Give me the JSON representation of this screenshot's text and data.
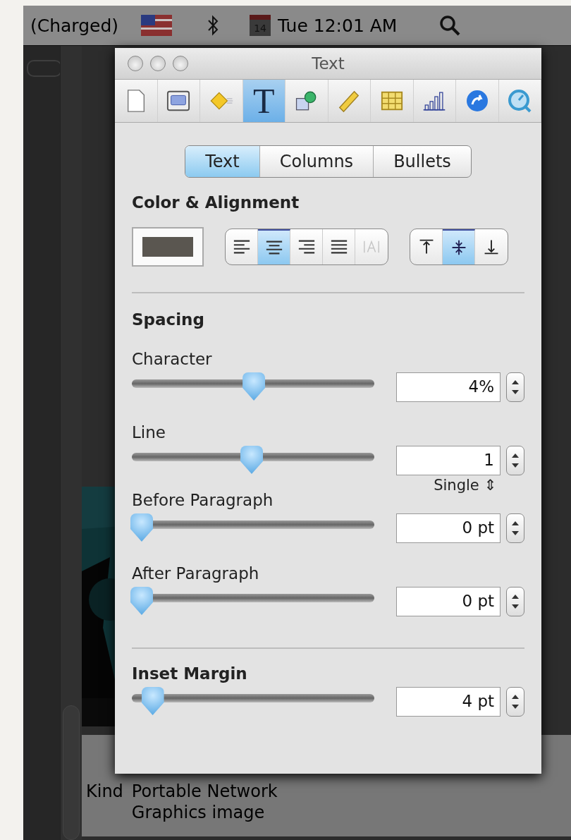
{
  "menu_bar": {
    "battery_status": "(Charged)",
    "calendar_day": "14",
    "clock": "Tue 12:01 AM"
  },
  "background_window": {
    "info": [
      {
        "label": "Kind",
        "value_lines": [
          "Portable Network",
          "Graphics image"
        ]
      }
    ]
  },
  "inspector": {
    "title": "Text",
    "toolbar": [
      {
        "kind": "document",
        "selected": false
      },
      {
        "kind": "layout",
        "selected": false
      },
      {
        "kind": "build",
        "selected": false
      },
      {
        "kind": "text",
        "glyph": "T",
        "selected": true
      },
      {
        "kind": "shape",
        "selected": false
      },
      {
        "kind": "ruler",
        "selected": false
      },
      {
        "kind": "table",
        "selected": false
      },
      {
        "kind": "chart",
        "selected": false
      },
      {
        "kind": "link",
        "selected": false
      },
      {
        "kind": "media",
        "selected": false
      }
    ],
    "tabs": [
      {
        "label": "Text",
        "selected": true
      },
      {
        "label": "Columns",
        "selected": false
      },
      {
        "label": "Bullets",
        "selected": false
      }
    ],
    "color_alignment": {
      "heading": "Color & Alignment",
      "horizontal": [
        {
          "kind": "left",
          "selected": false,
          "disabled": false
        },
        {
          "kind": "center",
          "selected": true,
          "disabled": false
        },
        {
          "kind": "right",
          "selected": false,
          "disabled": false
        },
        {
          "kind": "justify",
          "selected": false,
          "disabled": false
        },
        {
          "kind": "auto",
          "selected": false,
          "disabled": true
        }
      ],
      "vertical": [
        {
          "kind": "top",
          "selected": false
        },
        {
          "kind": "middle",
          "selected": true
        },
        {
          "kind": "bottom",
          "selected": false
        }
      ]
    },
    "spacing": {
      "heading": "Spacing",
      "rows": [
        {
          "label": "Character",
          "level": 0.51,
          "value": "4%"
        },
        {
          "label": "Line",
          "level": 0.5,
          "value": "1",
          "mode": "Single ⇕"
        },
        {
          "label": "Before Paragraph",
          "level": 0,
          "value": "0 pt"
        },
        {
          "label": "After Paragraph",
          "level": 0,
          "value": "0 pt"
        }
      ]
    },
    "inset_margin": {
      "heading": "Inset Margin",
      "level": 0.05,
      "value": "4 pt"
    }
  }
}
